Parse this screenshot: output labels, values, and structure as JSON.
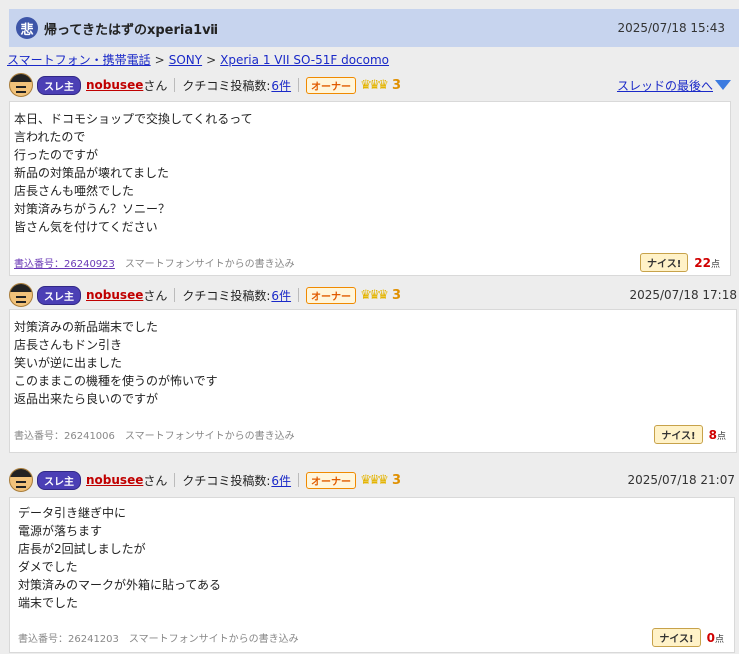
{
  "thread": {
    "badge": "悲",
    "title": "帰ってきたはずのxperia1ⅶ",
    "date": "2025/07/18 15:43"
  },
  "breadcrumb": [
    "スマートフォン・携帯電話",
    "SONY",
    "Xperia 1 VII SO-51F docomo"
  ],
  "breadcrumb_sep": ">",
  "last_link": "スレッドの最後へ",
  "posts": [
    {
      "owner_badge": "スレ主",
      "user": "nobusee",
      "user_suffix": "さん",
      "count_label": "クチコミ投稿数:",
      "count": "6件",
      "owner_tag": "オーナー",
      "rank": "3",
      "date": "",
      "body": "本日、ドコモショップで交換してくれるって\n言われたので\n行ったのですが\n新品の対策品が壊れてました\n店長さんも唖然でした\n対策済みちがうん？ソニー？\n皆さん気を付けてください",
      "post_no": "書込番号：26240923",
      "source": "スマートフォンサイトからの書き込み",
      "nice": "ナイス!",
      "points": "22",
      "unit": "点"
    },
    {
      "owner_badge": "スレ主",
      "user": "nobusee",
      "user_suffix": "さん",
      "count_label": "クチコミ投稿数:",
      "count": "6件",
      "owner_tag": "オーナー",
      "rank": "3",
      "date": "2025/07/18 17:18",
      "body": "対策済みの新品端末でした\n店長さんもドン引き\n笑いが逆に出ました\nこのままこの機種を使うのが怖いです\n返品出来たら良いのですが",
      "post_no": "書込番号：26241006",
      "source": "スマートフォンサイトからの書き込み",
      "nice": "ナイス!",
      "points": "8",
      "unit": "点"
    },
    {
      "owner_badge": "スレ主",
      "user": "nobusee",
      "user_suffix": "さん",
      "count_label": "クチコミ投稿数:",
      "count": "6件",
      "owner_tag": "オーナー",
      "rank": "3",
      "date": "2025/07/18 21:07",
      "body": "データ引き継ぎ中に\n電源が落ちます\n店長が2回試しましたが\nダメでした\n対策済みのマークが外箱に貼ってある\n端末でした",
      "post_no": "書込番号：26241203",
      "source": "スマートフォンサイトからの書き込み",
      "nice": "ナイス!",
      "points": "0",
      "unit": "点"
    }
  ],
  "colors": {
    "title_bar": "#c7d4ee",
    "link": "#1a29c8",
    "user": "#c00000",
    "badge": "#4b3fb5"
  }
}
